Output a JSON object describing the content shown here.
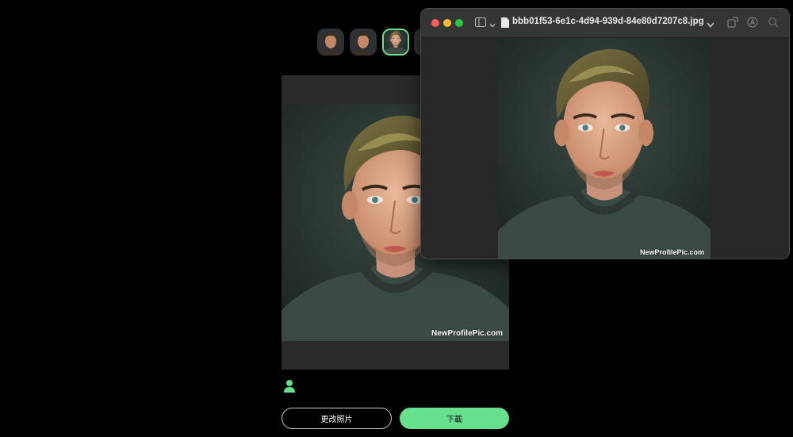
{
  "thumbnails": [
    {
      "name": "style-1"
    },
    {
      "name": "style-2"
    },
    {
      "name": "style-3",
      "selected": true
    },
    {
      "name": "style-4"
    }
  ],
  "preview": {
    "watermark": "NewProfilePic.com"
  },
  "actions": {
    "change_photo_label": "更改照片",
    "download_label": "下載"
  },
  "preview_window": {
    "title": "bbb01f53-6e1c-4d94-939d-84e80d7207c8.jpg",
    "watermark": "NewProfilePic.com"
  },
  "colors": {
    "accent_green": "#67e08d",
    "selected_border": "#6ee38d",
    "close": "#ff5f57",
    "minimize": "#febc2e",
    "zoom": "#28c840"
  }
}
